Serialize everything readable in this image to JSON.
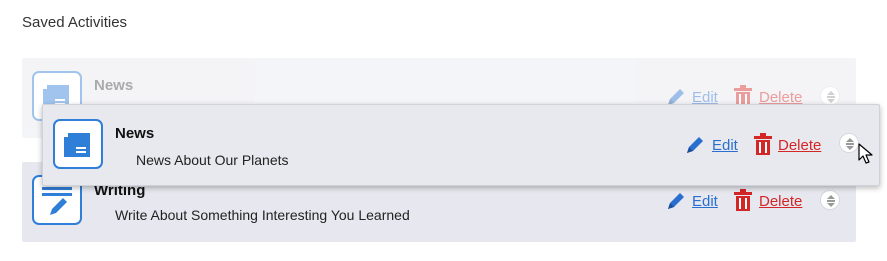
{
  "section_title": "Saved Activities",
  "activities": [
    {
      "title": "News",
      "description": "News About Our Planets",
      "edit_label": "Edit",
      "delete_label": "Delete",
      "icon": "newspaper-icon",
      "state": "drag-placeholder"
    },
    {
      "title": "Writing",
      "description": "Write About Something Interesting You Learned",
      "edit_label": "Edit",
      "delete_label": "Delete",
      "icon": "pencil-lines-icon",
      "state": "normal"
    }
  ],
  "dragging": {
    "title": "News",
    "description": "News About Our Planets",
    "edit_label": "Edit",
    "delete_label": "Delete",
    "icon": "newspaper-icon"
  },
  "colors": {
    "accent": "#2f7ed8",
    "link": "#2a6fd0",
    "danger": "#d32626",
    "row_bg": "#e7e8ef"
  }
}
